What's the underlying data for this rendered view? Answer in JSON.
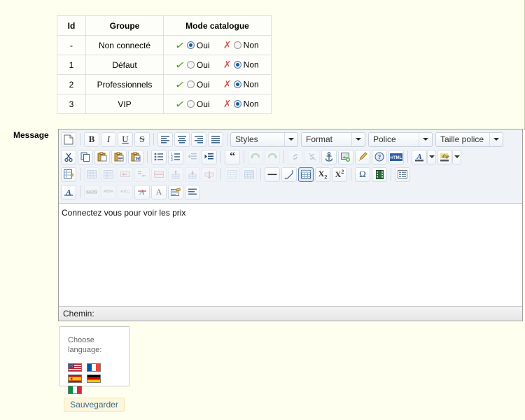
{
  "colors": {
    "page_background": "#fffff0",
    "toolbar_background": "#eff3f8",
    "accent_blue": "#1d5a96",
    "tick_green": "#5aa02c",
    "cross_red": "#d9534f",
    "save_background": "#fdf6dd"
  },
  "groups_table": {
    "headers": [
      "Id",
      "Groupe",
      "Mode catalogue"
    ],
    "rows": [
      {
        "id": "-",
        "groupe": "Non connecté",
        "oui_label": "Oui",
        "non_label": "Non",
        "selected": "oui"
      },
      {
        "id": "1",
        "groupe": "Défaut",
        "oui_label": "Oui",
        "non_label": "Non",
        "selected": "non"
      },
      {
        "id": "2",
        "groupe": "Professionnels",
        "oui_label": "Oui",
        "non_label": "Non",
        "selected": "non"
      },
      {
        "id": "3",
        "groupe": "VIP",
        "oui_label": "Oui",
        "non_label": "Non",
        "selected": "non"
      }
    ]
  },
  "message_field": {
    "label": "Message",
    "content": "Connectez vous pour voir les prix",
    "path_label": "Chemin:"
  },
  "editor_toolbar": {
    "dropdowns": [
      {
        "name": "styles",
        "value": "Styles"
      },
      {
        "name": "format",
        "value": "Format"
      },
      {
        "name": "police",
        "value": "Police"
      },
      {
        "name": "taille-police",
        "value": "Taille police"
      }
    ],
    "row1_icons": [
      "new-page-icon",
      "bold-icon",
      "italic-icon",
      "underline-icon",
      "strikethrough-icon",
      "align-left-icon",
      "align-center-icon",
      "align-right-icon",
      "align-justify-icon"
    ],
    "row2_icons": [
      "cut-icon",
      "copy-icon",
      "paste-icon",
      "paste-text-icon",
      "paste-word-icon",
      "bullet-list-icon",
      "numbered-list-icon",
      "outdent-icon",
      "indent-icon",
      "blockquote-icon",
      "undo-icon",
      "redo-icon",
      "link-icon",
      "unlink-icon",
      "anchor-icon",
      "image-icon",
      "paint-icon",
      "help-icon",
      "source-html-icon",
      "text-color-icon",
      "background-color-icon"
    ],
    "row3_icons": [
      "edit-table-icon",
      "table-properties-icon",
      "table-cell-icon",
      "merge-cells-icon",
      "split-cell-icon",
      "row-properties-icon",
      "insert-row-icon",
      "delete-row-icon",
      "column-icon",
      "table-grid-icon",
      "table-blue-icon",
      "horizontal-rule-icon",
      "eraser-icon",
      "insert-table-icon",
      "subscript-icon",
      "superscript-icon",
      "special-char-icon",
      "flash-icon",
      "form-icon"
    ],
    "row4_icons": [
      "spellcheck-icon",
      "quote-icon",
      "abbr-icon",
      "acronym-icon",
      "remove-format-icon",
      "font-style-icon",
      "templates-icon",
      "show-blocks-icon"
    ],
    "bold_label": "B",
    "italic_label": "I",
    "underline_label": "U",
    "strike_label": "S",
    "html_label": "HTML",
    "abbr_label": "ABBR",
    "acronym_label": "A.B.C.",
    "quote_label": "6699",
    "subscript_label": "X",
    "subscript_sub": "2",
    "superscript_label": "X",
    "superscript_sup": "2",
    "omega_label": "Ω",
    "blockquote_label": "“"
  },
  "language_box": {
    "title_line1": "Choose",
    "title_line2": "language:",
    "flags": [
      {
        "name": "flag-us",
        "country": "United States"
      },
      {
        "name": "flag-fr",
        "country": "France"
      },
      {
        "name": "flag-es",
        "country": "Spain"
      },
      {
        "name": "flag-de",
        "country": "Germany"
      },
      {
        "name": "flag-it",
        "country": "Italy"
      }
    ]
  },
  "save_button": {
    "label": "Sauvegarder"
  }
}
